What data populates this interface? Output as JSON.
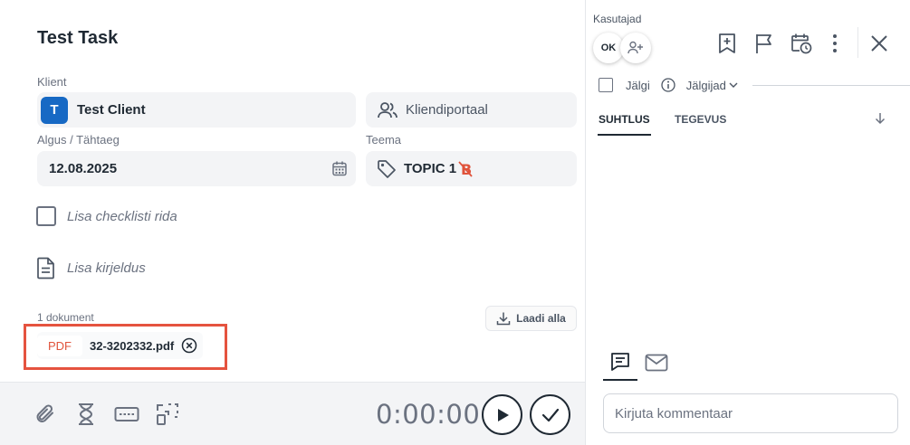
{
  "task": {
    "title": "Test Task"
  },
  "client": {
    "label": "Klient",
    "initial": "T",
    "name": "Test Client",
    "portal_label": "Kliendiportaal"
  },
  "dates": {
    "label": "Algus / Tähtaeg",
    "value": "12.08.2025"
  },
  "topic": {
    "label": "Teema",
    "value": "TOPIC 1"
  },
  "checklist": {
    "placeholder": "Lisa checklisti rida"
  },
  "description": {
    "placeholder": "Lisa kirjeldus"
  },
  "documents": {
    "count_label": "1 dokument",
    "download_label": "Laadi alla",
    "items": [
      {
        "type": "PDF",
        "name": "32-3202332.pdf"
      }
    ]
  },
  "timer": {
    "value": "0:00:00"
  },
  "users": {
    "label": "Kasutajad",
    "avatar_initials": "OK"
  },
  "follow": {
    "label": "Jälgi",
    "followers_label": "Jälgijad"
  },
  "tabs": [
    {
      "label": "SUHTLUS",
      "active": true
    },
    {
      "label": "TEGEVUS",
      "active": false
    }
  ],
  "comment": {
    "placeholder": "Kirjuta kommentaar"
  },
  "colors": {
    "client_badge": "#1769c4",
    "pdf_tag": "#e0533b",
    "highlight": "#e5533f",
    "topic_warning": "#e0533b"
  },
  "icons": {
    "bottom_bar": [
      "paperclip-icon",
      "hourglass-icon",
      "keyboard-icon",
      "scan-icon"
    ],
    "header": [
      "bookmark-add-icon",
      "flag-icon",
      "calendar-clock-icon",
      "more-vertical-icon",
      "close-icon"
    ]
  }
}
